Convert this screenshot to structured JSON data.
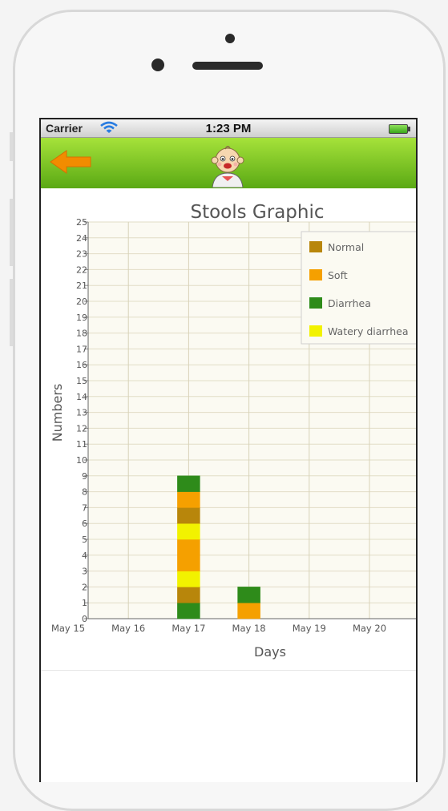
{
  "status_bar": {
    "carrier": "Carrier",
    "time": "1:23 PM"
  },
  "nav": {
    "back_icon": "back-arrow-icon",
    "logo_icon": "baby-face-icon"
  },
  "colors": {
    "nav_green": "#7cc520",
    "normal": "#b8860b",
    "soft": "#f5a000",
    "diarrhea": "#2e8b1a",
    "watery": "#f2f200",
    "back_orange": "#f28c00"
  },
  "chart_data": {
    "type": "bar",
    "stacked": true,
    "title": "Stools Graphic",
    "xlabel": "Days",
    "ylabel": "Numbers",
    "categories": [
      "May 15",
      "May 16",
      "May 17",
      "May 18",
      "May 19",
      "May 20"
    ],
    "ylim": [
      0,
      25
    ],
    "yticks": [
      "0",
      "1",
      "2",
      "3",
      "4",
      "5",
      "6",
      "7",
      "8",
      "9",
      "10",
      "11",
      "12",
      "13",
      "14",
      "15",
      "16",
      "17",
      "18",
      "19",
      "20",
      "21",
      "22",
      "23",
      "24",
      "25"
    ],
    "legend_placement": "top-right",
    "legend": [
      {
        "name": "Normal",
        "color": "#b8860b"
      },
      {
        "name": "Soft",
        "color": "#f5a000"
      },
      {
        "name": "Diarrhea",
        "color": "#2e8b1a"
      },
      {
        "name": "Watery diarrhea",
        "color": "#f2f200"
      }
    ],
    "stacks": [
      {
        "category": "May 17",
        "segments": [
          "Diarrhea",
          "Normal",
          "Watery diarrhea",
          "Soft",
          "Soft",
          "Watery diarrhea",
          "Normal",
          "Soft",
          "Diarrhea"
        ]
      },
      {
        "category": "May 18",
        "segments": [
          "Soft",
          "Diarrhea"
        ]
      }
    ],
    "series": [
      {
        "name": "Normal",
        "values": [
          0,
          0,
          2,
          0,
          0,
          0
        ]
      },
      {
        "name": "Soft",
        "values": [
          0,
          0,
          3,
          1,
          0,
          0
        ]
      },
      {
        "name": "Diarrhea",
        "values": [
          0,
          0,
          2,
          1,
          0,
          0
        ]
      },
      {
        "name": "Watery diarrhea",
        "values": [
          0,
          0,
          2,
          0,
          0,
          0
        ]
      }
    ],
    "grid": true
  }
}
